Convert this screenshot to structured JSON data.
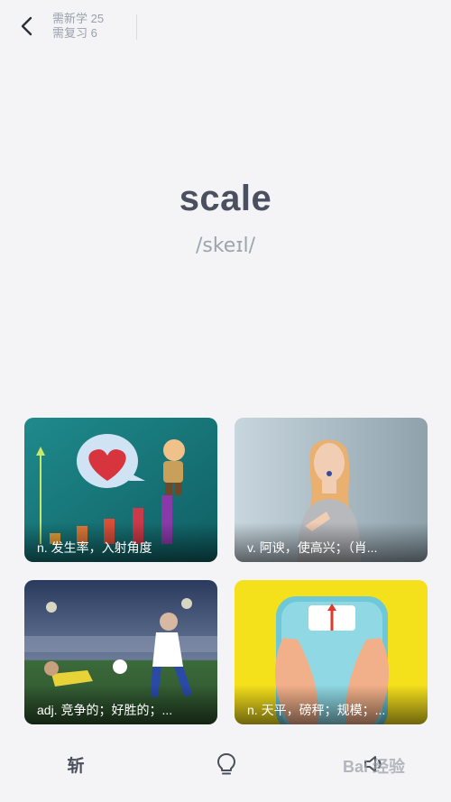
{
  "header": {
    "new_label": "需新学 25",
    "review_label": "需复习 6"
  },
  "word": {
    "text": "scale",
    "phonetic": "/skeɪl/"
  },
  "cards": [
    {
      "caption": "n. 发生率，入射角度"
    },
    {
      "caption": "v. 阿谀，使高兴；（肖..."
    },
    {
      "caption": "adj. 竞争的；好胜的；..."
    },
    {
      "caption": "n. 天平，磅秤；规模；..."
    }
  ],
  "bottom_bar": {
    "kill_label": "斩",
    "hint_icon": "lightbulb-icon",
    "sound_icon": "speaker-icon"
  },
  "watermark": "Bai 经验",
  "colors": {
    "background": "#f4f4f6",
    "word": "#4a5060",
    "muted": "#9ea3ad"
  }
}
